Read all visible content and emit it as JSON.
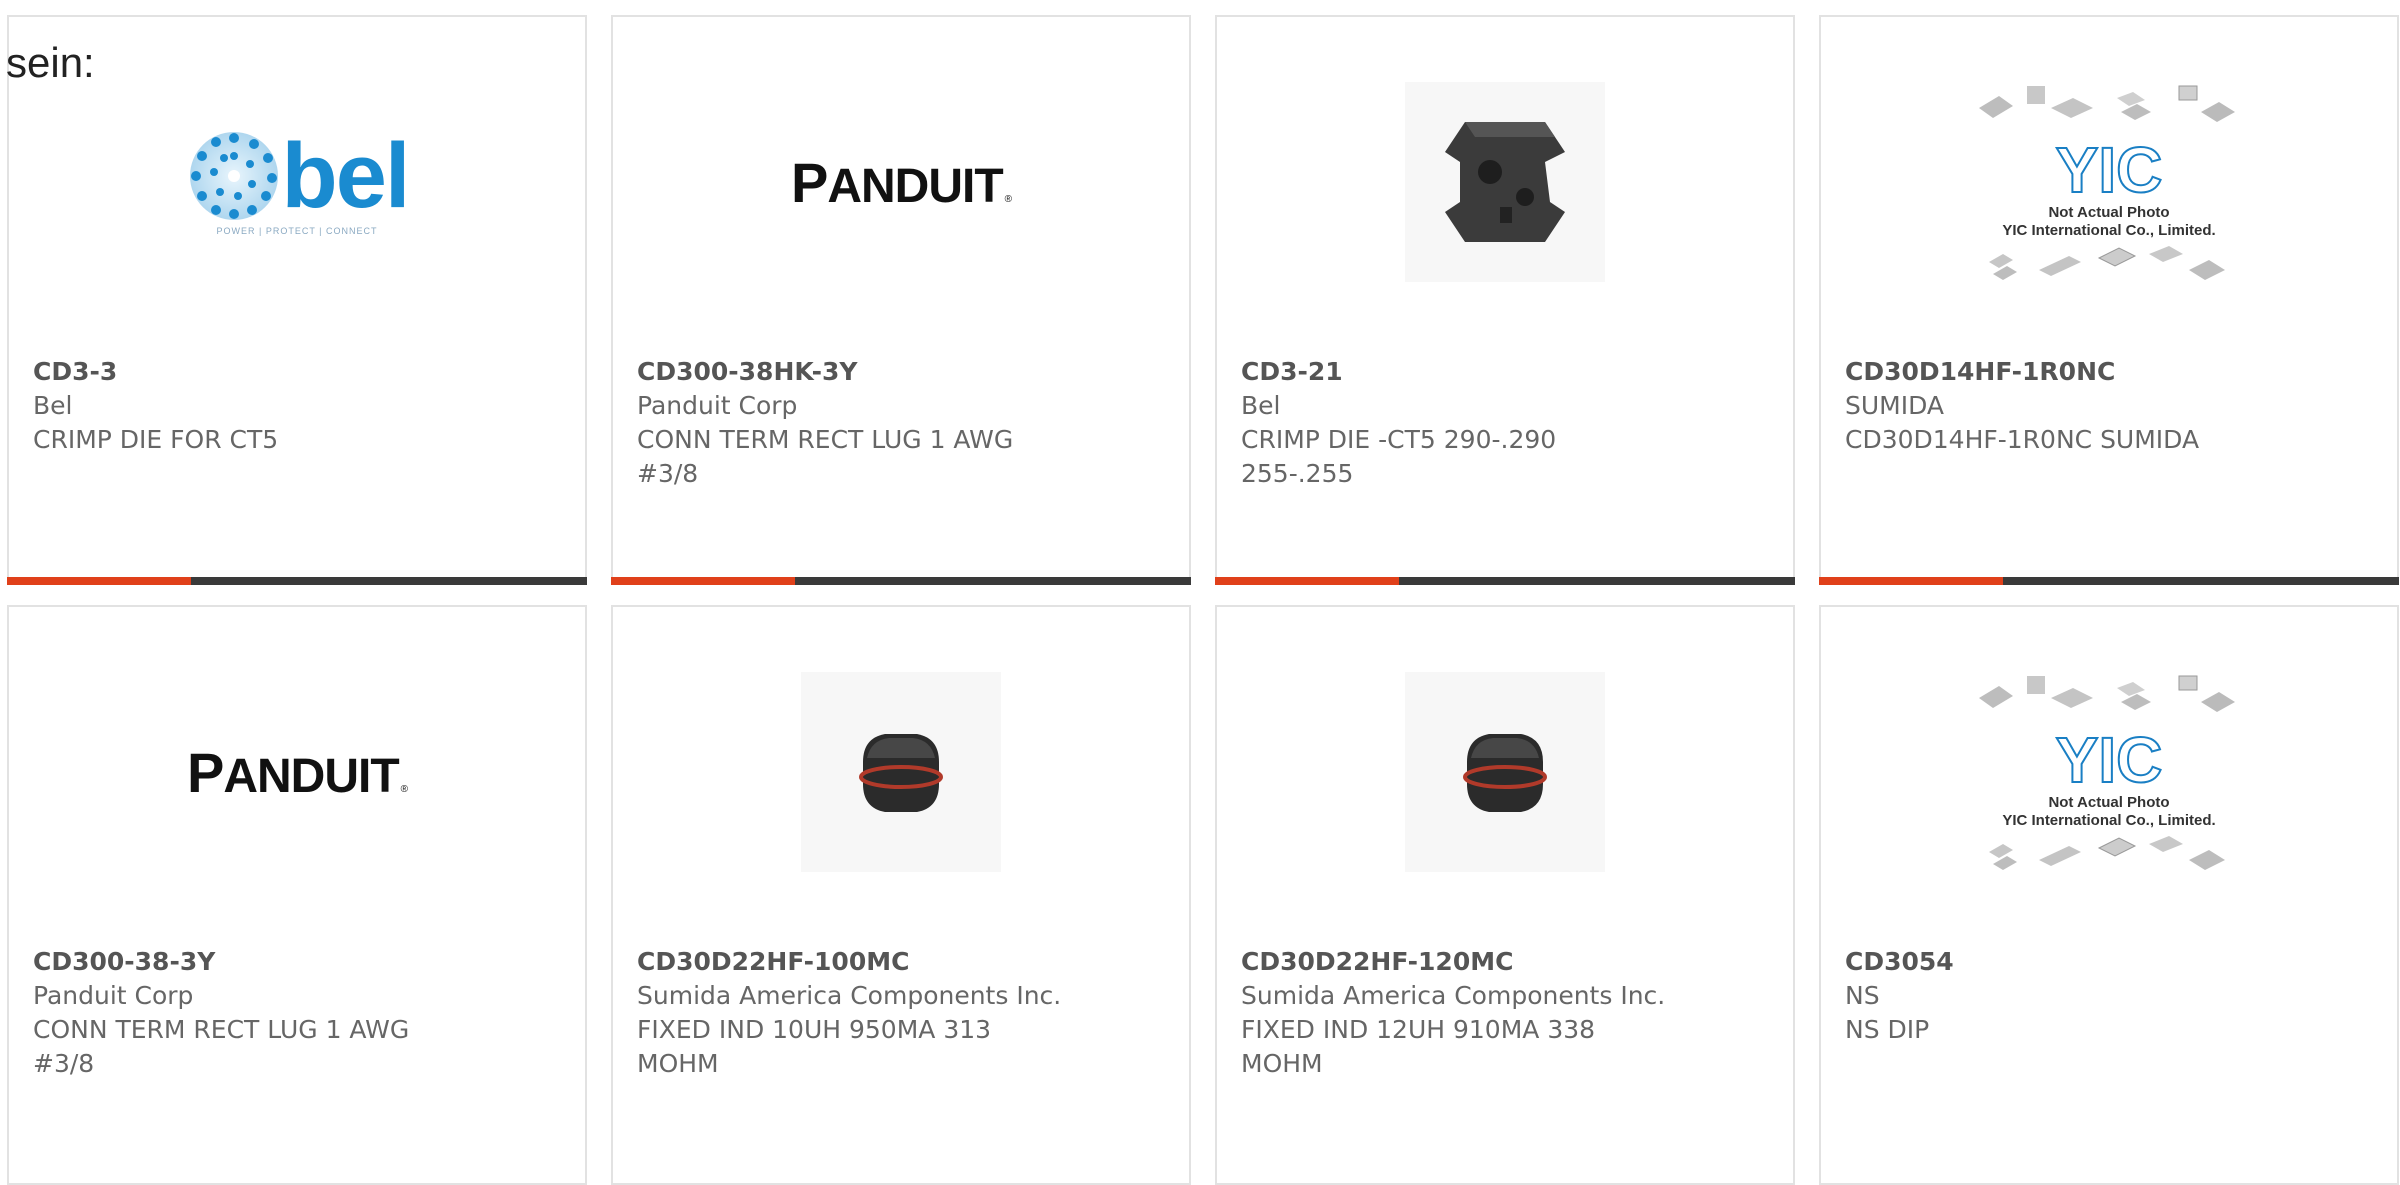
{
  "intro_text": "sein:",
  "accent_color": "#e0401a",
  "bar_color": "#3a3a3a",
  "logos": {
    "bel": {
      "text": "bel",
      "tagline": "POWER | PROTECT | CONNECT"
    },
    "panduit": {
      "first": "P",
      "rest": "ANDUIT",
      "mark": "®"
    },
    "yic": {
      "letters": "YIC",
      "note_line1": "Not Actual Photo",
      "note_line2": "YIC International Co., Limited."
    }
  },
  "products": [
    {
      "part": "CD3-3",
      "manufacturer": "Bel",
      "description": "CRIMP DIE FOR CT5",
      "image": "bel-logo"
    },
    {
      "part": "CD300-38HK-3Y",
      "manufacturer": "Panduit Corp",
      "description": "CONN TERM RECT LUG 1 AWG #3/8",
      "image": "panduit-logo"
    },
    {
      "part": "CD3-21",
      "manufacturer": "Bel",
      "description": "CRIMP DIE -CT5 290-.290 255-.255",
      "image": "crimp-die-photo"
    },
    {
      "part": "CD30D14HF-1R0NC",
      "manufacturer": "SUMIDA",
      "description": "CD30D14HF-1R0NC SUMIDA",
      "image": "yic-placeholder"
    },
    {
      "part": "CD300-38-3Y",
      "manufacturer": "Panduit Corp",
      "description": "CONN TERM RECT LUG 1 AWG #3/8",
      "image": "panduit-logo"
    },
    {
      "part": "CD30D22HF-100MC",
      "manufacturer": "Sumida America Components Inc.",
      "description": "FIXED IND 10UH 950MA 313 MOHM",
      "image": "inductor-photo"
    },
    {
      "part": "CD30D22HF-120MC",
      "manufacturer": "Sumida America Components Inc.",
      "description": "FIXED IND 12UH 910MA 338 MOHM",
      "image": "inductor-photo"
    },
    {
      "part": "CD3054",
      "manufacturer": "NS",
      "description": "NS DIP",
      "image": "yic-placeholder"
    }
  ]
}
